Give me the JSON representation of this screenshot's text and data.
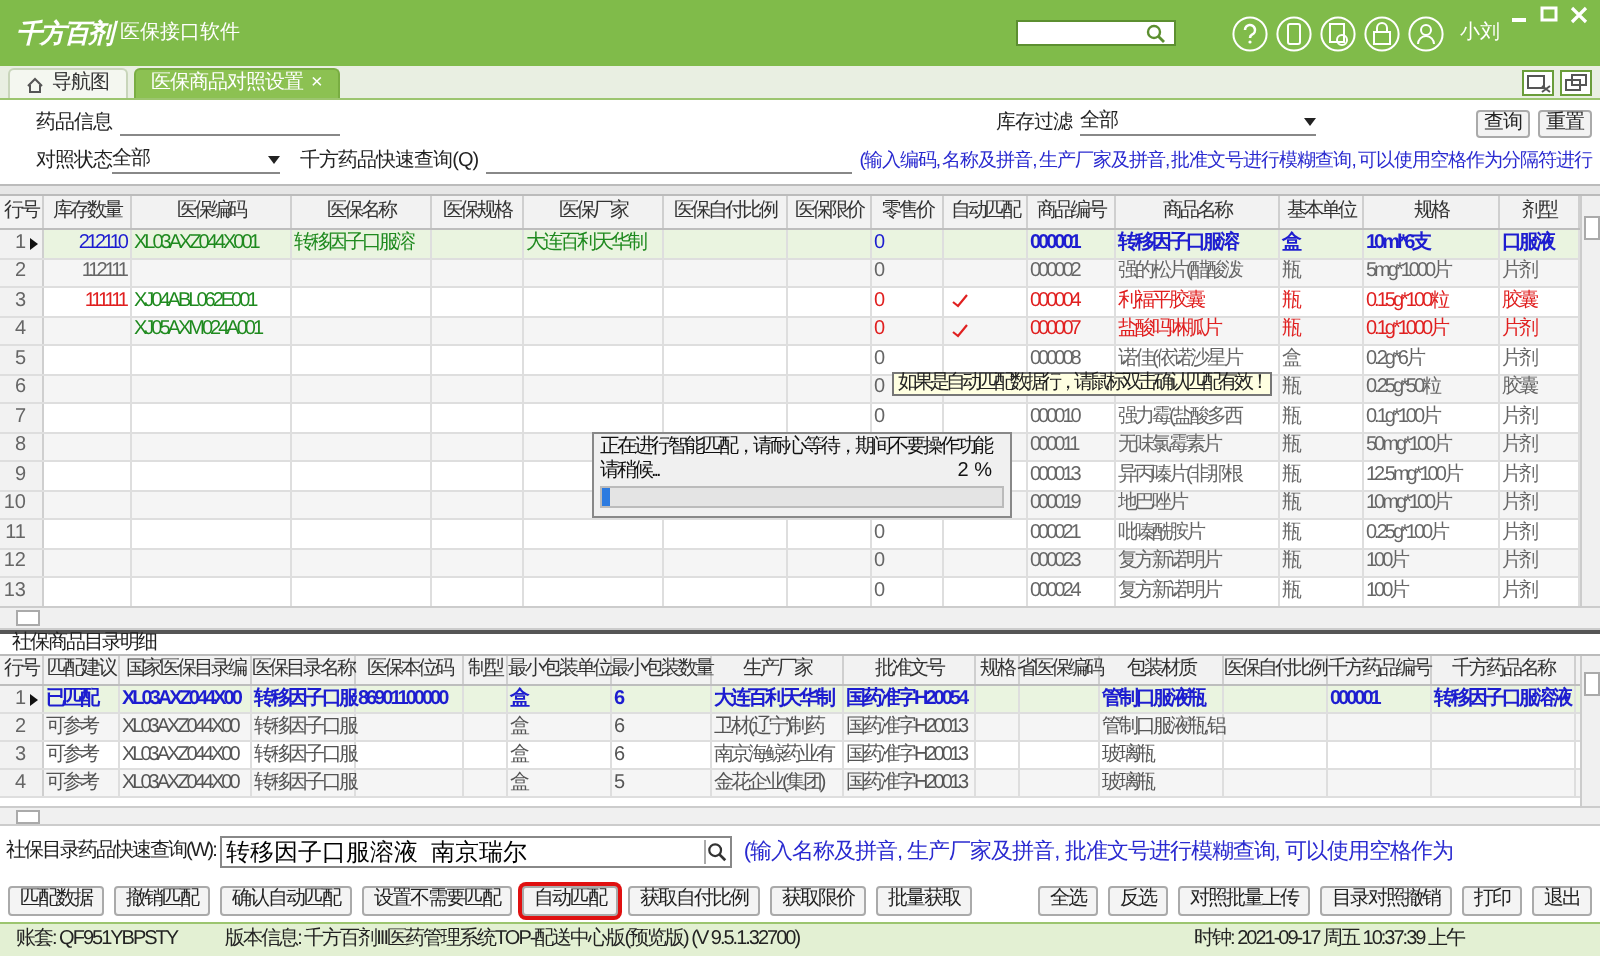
{
  "app": {
    "logo": "千方百剂",
    "title": "医保接口软件",
    "user": "小刘"
  },
  "tabs": [
    {
      "label": "导航图",
      "selected": false,
      "closable": false
    },
    {
      "label": "医保商品对照设置",
      "selected": true,
      "closable": true
    }
  ],
  "close_glyph": "×",
  "filters": {
    "drug_info_label": "药品信息",
    "stock_filter_label": "库存过滤",
    "stock_filter_value": "全部",
    "status_label": "对照状态",
    "status_value": "全部",
    "quick_search_label": "千方药品快速查询(Q)",
    "hint": "(输入编码, 名称及拼音, 生产厂家及拼音, 批准文号进行模糊查询, 可以使用空格作为分隔符进行",
    "buttons": [
      "查询",
      "重置"
    ]
  },
  "upper_table": {
    "row_number_header": "行号",
    "columns": [
      "库存数量",
      "医保编码",
      "医保名称",
      "医保规格",
      "医保厂家",
      "医保自付比例",
      "医保限价",
      "零售价",
      "自动匹配",
      "商品编号",
      "商品名称",
      "基本单位",
      "规格",
      "剂型"
    ],
    "rows": [
      {
        "row_number": "1",
        "selected": true,
        "kind": "matched",
        "auto_match": false,
        "cells": [
          "212110",
          "XL03AXZ044X001",
          "转移因子口服溶",
          null,
          "大连百利天华制",
          null,
          null,
          "0",
          null,
          "000001",
          "转移因子口服溶",
          "盒",
          "10ml*6支",
          "口服液"
        ]
      },
      {
        "row_number": "2",
        "selected": false,
        "kind": "none",
        "auto_match": false,
        "cells": [
          "112111",
          null,
          null,
          null,
          null,
          null,
          null,
          "0",
          null,
          "000002",
          "强的松片(醋酸泼",
          "瓶",
          "5mg*1000片",
          "片剂"
        ]
      },
      {
        "row_number": "3",
        "selected": false,
        "kind": "auto",
        "auto_match": true,
        "cells": [
          "111111",
          "XJ04ABL062E001",
          null,
          null,
          null,
          null,
          null,
          "0",
          null,
          "000004",
          "利福平胶囊",
          "瓶",
          "0.15g*100粒",
          "胶囊"
        ]
      },
      {
        "row_number": "4",
        "selected": false,
        "kind": "auto",
        "auto_match": true,
        "cells": [
          null,
          "XJ05AXM024A001",
          null,
          null,
          null,
          null,
          null,
          "0",
          null,
          "000007",
          "盐酸吗啉胍片",
          "瓶",
          "0.1g*1000片",
          "片剂"
        ]
      },
      {
        "row_number": "5",
        "selected": false,
        "kind": "none",
        "auto_match": false,
        "cells": [
          null,
          null,
          null,
          null,
          null,
          null,
          null,
          "0",
          null,
          "000008",
          "诺佳(依诺沙星片",
          "盒",
          "0.2g*6片",
          "片剂"
        ]
      },
      {
        "row_number": "6",
        "selected": false,
        "kind": "none",
        "auto_match": false,
        "cells": [
          null,
          null,
          null,
          null,
          null,
          null,
          null,
          "0",
          null,
          null,
          null,
          "瓶",
          "0.25g*50粒",
          "胶囊"
        ]
      },
      {
        "row_number": "7",
        "selected": false,
        "kind": "none",
        "auto_match": false,
        "cells": [
          null,
          null,
          null,
          null,
          null,
          null,
          null,
          "0",
          null,
          "000010",
          "强力霉(盐酸多西",
          "瓶",
          "0.1g*100片",
          "片剂"
        ]
      },
      {
        "row_number": "8",
        "selected": false,
        "kind": "none",
        "auto_match": false,
        "cells": [
          null,
          null,
          null,
          null,
          null,
          null,
          null,
          null,
          null,
          "000011",
          "无味氯霉素片",
          "瓶",
          "50mg*100片",
          "片剂"
        ]
      },
      {
        "row_number": "9",
        "selected": false,
        "kind": "none",
        "auto_match": false,
        "cells": [
          null,
          null,
          null,
          null,
          null,
          null,
          null,
          null,
          null,
          "000013",
          "异丙嗪片(非那根",
          "瓶",
          "12.5mg*100片",
          "片剂"
        ]
      },
      {
        "row_number": "10",
        "selected": false,
        "kind": "none",
        "auto_match": false,
        "cells": [
          null,
          null,
          null,
          null,
          null,
          null,
          null,
          null,
          null,
          "000019",
          "地巴唑片",
          "瓶",
          "10mg*100片",
          "片剂"
        ]
      },
      {
        "row_number": "11",
        "selected": false,
        "kind": "none",
        "auto_match": false,
        "cells": [
          null,
          null,
          null,
          null,
          null,
          null,
          null,
          "0",
          null,
          "000021",
          "吡嗪酰胺片",
          "瓶",
          "0.25g*100片",
          "片剂"
        ]
      },
      {
        "row_number": "12",
        "selected": false,
        "kind": "none",
        "auto_match": false,
        "cells": [
          null,
          null,
          null,
          null,
          null,
          null,
          null,
          "0",
          null,
          "000023",
          "复方新诺明片",
          "瓶",
          "100片",
          "片剂"
        ]
      },
      {
        "row_number": "13",
        "selected": false,
        "kind": "none",
        "auto_match": false,
        "cells": [
          null,
          null,
          null,
          null,
          null,
          null,
          null,
          "0",
          null,
          "000024",
          "复方新诺明片",
          "瓶",
          "100片",
          "片剂"
        ]
      }
    ]
  },
  "tooltip": "如果是自动匹配数据行，请鼠标双击确认匹配有效！",
  "progress_dialog": {
    "message": "正在进行智能匹配，请耐心等待，期间不要操作功能",
    "wait": "请稍候...",
    "percent": "2 %",
    "level": 0.02
  },
  "lower_section_title": "社保商品目录明细",
  "lower_table": {
    "row_number_header": "行号",
    "columns": [
      "匹配建议",
      "国家医保目录编",
      "医保目录名称",
      "医保本位码",
      "制型",
      "最小包装单位",
      "最小包装数量",
      "生产厂家",
      "批准文号",
      "规格",
      "省医保编码",
      "包装材质",
      "医保自付比例",
      "千方药品编号",
      "千方药品名称"
    ],
    "rows": [
      {
        "row_number": "1",
        "selected": true,
        "kind": "matched",
        "cells": [
          "已匹配",
          "XL03AXZ044X00",
          "转移因子口服",
          "86901100000",
          null,
          "盒",
          "6",
          "大连百利天华制",
          "国药准字H20054",
          null,
          null,
          "管制口服液瓶",
          null,
          "000001",
          "转移因子口服溶液"
        ]
      },
      {
        "row_number": "2",
        "selected": false,
        "kind": "reference",
        "cells": [
          "可参考",
          "XL03AXZ044X00",
          "转移因子口服",
          null,
          null,
          "盒",
          "6",
          "卫材(辽宁)制药",
          "国药准字H20013",
          null,
          null,
          "管制口服液瓶,铝",
          null,
          null,
          null
        ]
      },
      {
        "row_number": "3",
        "selected": false,
        "kind": "reference",
        "cells": [
          "可参考",
          "XL03AXZ044X00",
          "转移因子口服",
          null,
          null,
          "盒",
          "6",
          "南京海鲸药业有",
          "国药准字H20013",
          null,
          null,
          "玻璃瓶",
          null,
          null,
          null
        ]
      },
      {
        "row_number": "4",
        "selected": false,
        "kind": "reference",
        "cells": [
          "可参考",
          "XL03AXZ044X00",
          "转移因子口服",
          null,
          null,
          "盒",
          "5",
          "金花企业(集团)",
          "国药准字H20013",
          null,
          null,
          "玻璃瓶",
          null,
          null,
          null
        ]
      }
    ]
  },
  "catalog_search": {
    "label": "社保目录药品快速查询(W):",
    "value": "转移因子口服溶液  南京瑞尔",
    "hint": "(输入名称及拼音, 生产厂家及拼音, 批准文号进行模糊查询, 可以使用空格作为"
  },
  "left_buttons": [
    {
      "label": "匹配数据",
      "highlighted": false
    },
    {
      "label": "撤销匹配",
      "highlighted": false
    },
    {
      "label": "确认自动匹配",
      "highlighted": false
    },
    {
      "label": "设置不需要匹配",
      "highlighted": false
    },
    {
      "label": "自动匹配",
      "highlighted": true
    },
    {
      "label": "获取自付比例",
      "highlighted": false
    },
    {
      "label": "获取限价",
      "highlighted": false
    },
    {
      "label": "批量获取",
      "highlighted": false
    }
  ],
  "right_buttons": [
    {
      "label": "全选",
      "highlighted": false
    },
    {
      "label": "反选",
      "highlighted": false
    },
    {
      "label": "对照批量上传",
      "highlighted": false
    },
    {
      "label": "目录对照撤销",
      "highlighted": false
    },
    {
      "label": "打印",
      "highlighted": false
    },
    {
      "label": "退出",
      "highlighted": false
    }
  ],
  "status_bar": {
    "account": "账套: QF951YBPSTY",
    "version": "版本信息: 千方百剂III医药管理系统TOP-配送中心版(预览版)  (V 9.5.1.32700)",
    "clock": "时钟: 2021-09-17 周五 10:37:39 上午"
  }
}
